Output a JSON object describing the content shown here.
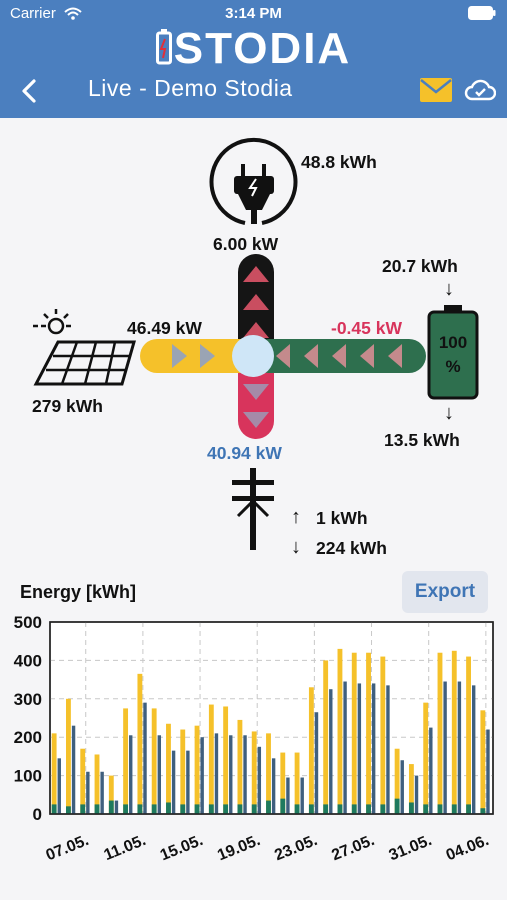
{
  "status_bar": {
    "carrier": "Carrier",
    "time": "3:14 PM"
  },
  "app": {
    "logo": "STODIA",
    "title": "Live - Demo Stodia"
  },
  "icons": {
    "back": "back-chevron-icon",
    "mail": "mail-icon",
    "cloud": "cloud-check-icon",
    "wifi": "wifi-icon",
    "battery": "battery-status-icon",
    "plug": "plug-icon",
    "sun": "sun-icon",
    "solar": "solar-panel-icon",
    "pole": "power-pole-icon"
  },
  "colors": {
    "header": "#4b7fbf",
    "solar": "#f5c12a",
    "battery": "#2e6f4e",
    "grid_import": "#d8345c",
    "load": "#1a1a1a",
    "accent": "#3f75b5"
  },
  "flow": {
    "consumption_energy": "48.8 kWh",
    "consumption_power": "6.00 kW",
    "solar_power": "46.49 kW",
    "solar_energy": "279 kWh",
    "battery_power": "-0.45 kW",
    "battery_charged": "20.7 kWh",
    "battery_discharged": "13.5 kWh",
    "battery_soc_value": "100",
    "battery_soc_unit": "%",
    "grid_power": "40.94 kW",
    "grid_export": "1 kWh",
    "grid_import": "224 kWh",
    "arrow_up": "↑",
    "arrow_down": "↓"
  },
  "energy_chart": {
    "title": "Energy [kWh]",
    "export_label": "Export"
  },
  "chart_data": {
    "type": "bar",
    "ylim": [
      0,
      500
    ],
    "yticks": [
      0,
      100,
      200,
      300,
      400,
      500
    ],
    "xtick_labels": [
      "07.05.",
      "11.05.",
      "15.05.",
      "19.05.",
      "23.05.",
      "27.05.",
      "31.05.",
      "04.06."
    ],
    "days": 30,
    "series": [
      {
        "color": "#f5c12a",
        "values": [
          210,
          300,
          170,
          155,
          100,
          275,
          365,
          275,
          235,
          220,
          230,
          285,
          280,
          245,
          215,
          210,
          160,
          160,
          330,
          400,
          430,
          420,
          420,
          410,
          170,
          130,
          290,
          420,
          425,
          410,
          270
        ]
      },
      {
        "color": "#3f5f7e",
        "values": [
          145,
          230,
          110,
          110,
          35,
          205,
          290,
          205,
          165,
          165,
          200,
          210,
          205,
          205,
          175,
          145,
          95,
          95,
          265,
          325,
          345,
          340,
          340,
          335,
          140,
          100,
          225,
          345,
          345,
          335,
          220
        ]
      },
      {
        "color": "#1e7a5e",
        "values": [
          25,
          20,
          25,
          25,
          35,
          25,
          25,
          25,
          30,
          25,
          25,
          25,
          25,
          25,
          25,
          35,
          40,
          25,
          25,
          25,
          25,
          25,
          25,
          25,
          40,
          30,
          25,
          25,
          25,
          25,
          15
        ]
      }
    ]
  }
}
